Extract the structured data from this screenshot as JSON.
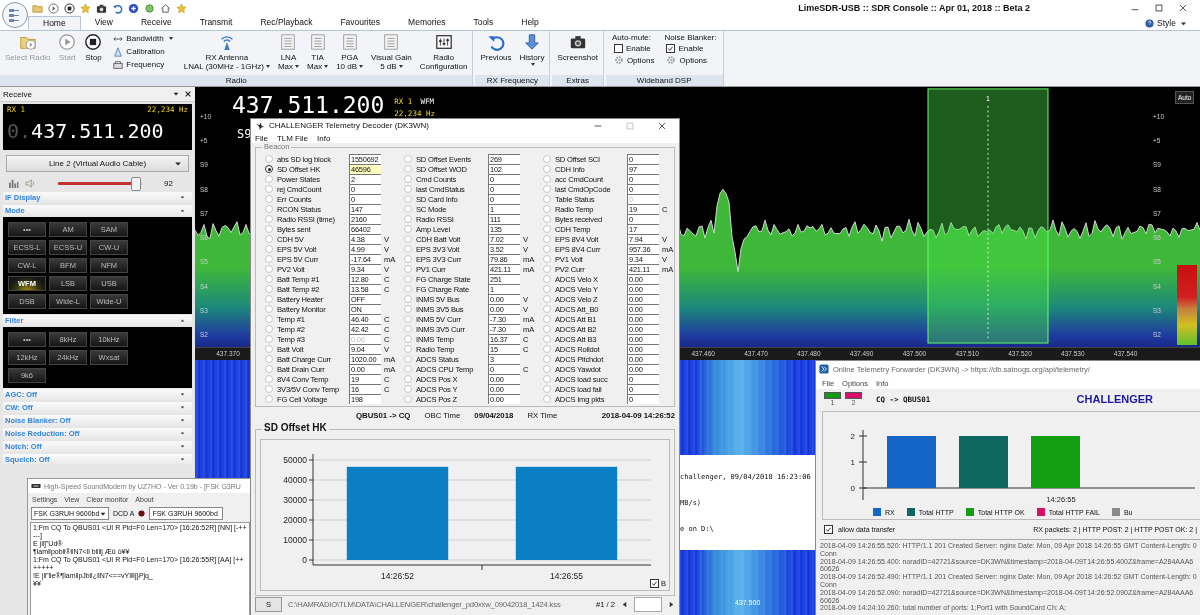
{
  "window": {
    "title": "LimeSDR-USB :: SDR Console :: Apr 01, 2018 :: Beta 2",
    "style_menu": "Style"
  },
  "tabs": [
    {
      "label": "Home",
      "selected": true
    },
    {
      "label": "View",
      "selected": false
    },
    {
      "label": "Receive",
      "selected": false
    },
    {
      "label": "Transmit",
      "selected": false
    },
    {
      "label": "Rec/Playback",
      "selected": false
    },
    {
      "label": "Favourites",
      "selected": false
    },
    {
      "label": "Memories",
      "selected": false
    },
    {
      "label": "Tools",
      "selected": false
    },
    {
      "label": "Help",
      "selected": false
    }
  ],
  "ribbon": [
    {
      "title": "Radio",
      "items": [
        {
          "kind": "large",
          "label": "Select Radio",
          "disabled": true,
          "dropdown": false
        },
        {
          "kind": "large",
          "label": "Start",
          "disabled": true,
          "dropdown": false
        },
        {
          "kind": "large",
          "label": "Stop",
          "disabled": false,
          "dropdown": false
        },
        {
          "kind": "stack",
          "rows": [
            {
              "label": "Bandwidth",
              "dropdown": true
            },
            {
              "label": "Calibration",
              "dropdown": false
            },
            {
              "label": "Frequency",
              "dropdown": false
            }
          ]
        },
        {
          "kind": "large",
          "label": "RX Antenna",
          "sub": "LNAL (30MHz - 1GHz)",
          "disabled": false,
          "dropdown": true
        },
        {
          "kind": "large",
          "label": "LNA",
          "sub": "Max",
          "disabled": false,
          "dropdown": true
        },
        {
          "kind": "large",
          "label": "TIA",
          "sub": "Max",
          "disabled": false,
          "dropdown": true
        },
        {
          "kind": "large",
          "label": "PGA",
          "sub": "10 dB",
          "disabled": false,
          "dropdown": true
        },
        {
          "kind": "large",
          "label": "Visual Gain",
          "sub": "5 dB",
          "disabled": false,
          "dropdown": true
        },
        {
          "kind": "large",
          "label": "Radio",
          "sub": "Configuration",
          "disabled": false,
          "dropdown": false
        }
      ]
    },
    {
      "title": "RX Frequency",
      "items": [
        {
          "kind": "large",
          "label": "Previous",
          "disabled": false,
          "dropdown": false
        },
        {
          "kind": "large",
          "label": "History",
          "disabled": false,
          "dropdown": true
        }
      ]
    },
    {
      "title": "Extras",
      "items": [
        {
          "kind": "large",
          "label": "Screenshot",
          "disabled": false,
          "dropdown": false
        }
      ]
    },
    {
      "title": "Wideband DSP",
      "items": [
        {
          "kind": "checks",
          "label": "Auto-mute:",
          "check": "Enable",
          "checked": false,
          "options": "Options"
        },
        {
          "kind": "checks",
          "label": "Noise Blanker:",
          "check": "Enable",
          "checked": true,
          "options": "Options"
        }
      ]
    }
  ],
  "receive_panel": {
    "title": "Receive",
    "rx": "RX 1",
    "offset": "22,234 Hz",
    "freq_prefix": "0.",
    "freq": "437.511.200",
    "audio_device": "Line 2 (Virtual Audio Cable)",
    "volume": {
      "level": 0.92,
      "reading": "92"
    },
    "sections": [
      {
        "title": "IF Display",
        "expanded": false
      },
      {
        "title": "Mode",
        "expanded": true,
        "buttons": [
          {
            "label": "•••",
            "selected": false
          },
          {
            "label": "AM",
            "selected": false
          },
          {
            "label": "SAM",
            "selected": false
          },
          {
            "label": "ECSS-L",
            "selected": false
          },
          {
            "label": "ECSS-U",
            "selected": false
          },
          {
            "label": "CW-U",
            "selected": false
          },
          {
            "label": "CW-L",
            "selected": false
          },
          {
            "label": "BFM",
            "selected": false
          },
          {
            "label": "NFM",
            "selected": false
          },
          {
            "label": "WFM",
            "selected": true
          },
          {
            "label": "LSB",
            "selected": false
          },
          {
            "label": "USB",
            "selected": false
          },
          {
            "label": "DSB",
            "selected": false
          },
          {
            "label": "Wide-L",
            "selected": false
          },
          {
            "label": "Wide-U",
            "selected": false
          }
        ]
      },
      {
        "title": "Filter",
        "expanded": true,
        "buttons": [
          {
            "label": "•••",
            "selected": false
          },
          {
            "label": "8kHz",
            "selected": false
          },
          {
            "label": "10kHz",
            "selected": false
          },
          {
            "label": "12kHz",
            "selected": false
          },
          {
            "label": "24kHz",
            "selected": false
          },
          {
            "label": "Wxsat",
            "selected": false
          },
          {
            "label": "9k6",
            "selected": false
          }
        ]
      },
      {
        "title": "AGC: Off",
        "expanded": false
      },
      {
        "title": "CW: Off",
        "expanded": false
      },
      {
        "title": "Noise Blanker: Off",
        "expanded": false
      },
      {
        "title": "Noise Reduction: Off",
        "expanded": false
      },
      {
        "title": "Notch: Off",
        "expanded": false
      },
      {
        "title": "Squelch: Off",
        "expanded": false
      }
    ]
  },
  "spectrum": {
    "freq": "437.511.200",
    "rx": "RX 1",
    "mode": "WFM",
    "offset": "22,234 Hz",
    "s_meter": "S9",
    "auto_button": "Auto",
    "selection_label": "1",
    "scale": [
      "+10",
      "+5",
      "S9",
      "S8",
      "S7",
      "S6",
      "S5",
      "S4",
      "S3",
      "S2"
    ],
    "scale_right": [
      "+10",
      "+5",
      "S9",
      "S8",
      "S7",
      "S6",
      "S5",
      "S4",
      "S3",
      "S2"
    ],
    "axis": [
      "437.370",
      "437.460",
      "437.470",
      "437.480",
      "437.490",
      "437.500",
      "437.510",
      "437.520",
      "437.530",
      "437.540"
    ],
    "waterfall_label": "437.500"
  },
  "background_window": {
    "lines": [
      "challenger,  09/04/2018 16:23:06",
      "MB/s)",
      "e on D:\\"
    ]
  },
  "decoder": {
    "title": "CHALLENGER Telemetry Decoder (DK3WN)",
    "menu": [
      "File",
      "TLM File",
      "Info"
    ],
    "beacon": {
      "title": "Beacon",
      "columns": [
        [
          {
            "label": "abs SD log block",
            "value": "1550692",
            "selected": false,
            "disabled": false
          },
          {
            "label": "SD Offset HK",
            "value": "46596",
            "selected": true,
            "disabled": false
          },
          {
            "label": "Power States",
            "value": "2",
            "selected": false,
            "disabled": false
          },
          {
            "label": "rej CmdCount",
            "value": "0",
            "selected": false,
            "disabled": false
          },
          {
            "label": "Err Counts",
            "value": "0",
            "selected": false,
            "disabled": false
          },
          {
            "label": "RCON Status",
            "value": "147",
            "selected": false,
            "disabled": false
          },
          {
            "label": "Radio RSSI (time)",
            "value": "2160",
            "selected": false,
            "disabled": false
          },
          {
            "label": "Bytes sent",
            "value": "66402",
            "selected": false,
            "disabled": false
          },
          {
            "label": "CDH 5V",
            "value": "4.38",
            "unit": "V",
            "selected": false,
            "disabled": false
          },
          {
            "label": "EPS 5V Volt",
            "value": "4.99",
            "unit": "V",
            "selected": false,
            "disabled": false
          },
          {
            "label": "EPS 5V Curr",
            "value": "-17.64",
            "unit": "mA",
            "selected": false,
            "disabled": false
          },
          {
            "label": "PV2 Volt",
            "value": "9.34",
            "unit": "V",
            "selected": false,
            "disabled": false
          },
          {
            "label": "Batt Temp #1",
            "value": "12.80",
            "unit": "C",
            "selected": false,
            "disabled": false
          },
          {
            "label": "Batt Temp #2",
            "value": "13.58",
            "unit": "C",
            "selected": false,
            "disabled": false
          },
          {
            "label": "Battery Heater",
            "value": "OFF",
            "selected": false,
            "disabled": false
          },
          {
            "label": "Battery Monitor",
            "value": "ON",
            "selected": false,
            "disabled": false
          },
          {
            "label": "Temp #1",
            "value": "46.40",
            "unit": "C",
            "selected": false,
            "disabled": false
          },
          {
            "label": "Temp #2",
            "value": "42.42",
            "unit": "C",
            "selected": false,
            "disabled": false
          },
          {
            "label": "Temp #3",
            "value": "0.00",
            "unit": "C",
            "selected": false,
            "disabled": true
          },
          {
            "label": "Batt Volt",
            "value": "9.04",
            "unit": "V",
            "selected": false,
            "disabled": false
          },
          {
            "label": "Batt Charge Curr",
            "value": "1020.00",
            "unit": "mA",
            "selected": false,
            "disabled": false
          },
          {
            "label": "Batt Drain Curr",
            "value": "0.00",
            "unit": "mA",
            "selected": false,
            "disabled": false
          },
          {
            "label": "8V4 Conv Temp",
            "value": "19",
            "unit": "C",
            "selected": false,
            "disabled": false
          },
          {
            "label": "3V3/5V Conv Temp",
            "value": "16",
            "unit": "C",
            "selected": false,
            "disabled": false
          },
          {
            "label": "FG Cell Voltage",
            "value": "198",
            "selected": false,
            "disabled": false
          }
        ],
        [
          {
            "label": "SD Offset Events",
            "value": "269",
            "selected": false,
            "disabled": false
          },
          {
            "label": "SD Offset WOD",
            "value": "102",
            "selected": false,
            "disabled": false
          },
          {
            "label": "Cmd Counts",
            "value": "0",
            "selected": false,
            "disabled": false
          },
          {
            "label": "last CmdStatus",
            "value": "0",
            "selected": false,
            "disabled": false
          },
          {
            "label": "SD Card Info",
            "value": "0",
            "selected": false,
            "disabled": false
          },
          {
            "label": "SC Mode",
            "value": "1",
            "selected": false,
            "disabled": false
          },
          {
            "label": "Radio RSSI",
            "value": "111",
            "selected": false,
            "disabled": false
          },
          {
            "label": "Amp Level",
            "value": "135",
            "selected": false,
            "disabled": false
          },
          {
            "label": "CDH Batt Volt",
            "value": "7.02",
            "unit": "V",
            "selected": false,
            "disabled": false
          },
          {
            "label": "EPS 3V3 Volt",
            "value": "3.52",
            "unit": "V",
            "selected": false,
            "disabled": false
          },
          {
            "label": "EPS 3V3 Curr",
            "value": "79.86",
            "unit": "mA",
            "selected": false,
            "disabled": false
          },
          {
            "label": "PV1 Curr",
            "value": "421.11",
            "unit": "mA",
            "selected": false,
            "disabled": false
          },
          {
            "label": "FG Charge State",
            "value": "251",
            "selected": false,
            "disabled": false
          },
          {
            "label": "FG Charge Rate",
            "value": "1",
            "selected": false,
            "disabled": false
          },
          {
            "label": "INMS 5V Bus",
            "value": "0.00",
            "unit": "V",
            "selected": false,
            "disabled": false
          },
          {
            "label": "INMS 3V5 Bus",
            "value": "0.00",
            "unit": "V",
            "selected": false,
            "disabled": false
          },
          {
            "label": "INMS 5V Curr",
            "value": "-7.30",
            "unit": "mA",
            "selected": false,
            "disabled": false
          },
          {
            "label": "INMS 3V5 Curr",
            "value": "-7.30",
            "unit": "mA",
            "selected": false,
            "disabled": false
          },
          {
            "label": "INMS Temp",
            "value": "16.37",
            "unit": "C",
            "selected": false,
            "disabled": false
          },
          {
            "label": "Radio Temp",
            "value": "15",
            "unit": "C",
            "selected": false,
            "disabled": false
          },
          {
            "label": "ADCS Status",
            "value": "3",
            "selected": false,
            "disabled": false
          },
          {
            "label": "ADCS CPU Temp",
            "value": "0",
            "unit": "C",
            "selected": false,
            "disabled": false
          },
          {
            "label": "ADCS Pos X",
            "value": "0.00",
            "selected": false,
            "disabled": false
          },
          {
            "label": "ADCS Pos Y",
            "value": "0.00",
            "selected": false,
            "disabled": false
          },
          {
            "label": "ADCS Pos Z",
            "value": "0.00",
            "selected": false,
            "disabled": false
          }
        ],
        [
          {
            "label": "SD Offset SCI",
            "value": "0",
            "selected": false,
            "disabled": false
          },
          {
            "label": "CDH Info",
            "value": "97",
            "selected": false,
            "disabled": false
          },
          {
            "label": "acc CmdCount",
            "value": "0",
            "selected": false,
            "disabled": false
          },
          {
            "label": "last CmdOpCode",
            "value": "0",
            "selected": false,
            "disabled": false
          },
          {
            "label": "Table Status",
            "value": "0",
            "selected": false,
            "disabled": true
          },
          {
            "label": "Radio Temp",
            "value": "19",
            "unit": "C",
            "selected": false,
            "disabled": false
          },
          {
            "label": "Bytes received",
            "value": "0",
            "selected": false,
            "disabled": false
          },
          {
            "label": "CDH Temp",
            "value": "17",
            "selected": false,
            "disabled": false
          },
          {
            "label": "EPS 8V4 Volt",
            "value": "7.94",
            "unit": "V",
            "selected": false,
            "disabled": false
          },
          {
            "label": "EPS 8V4 Curr",
            "value": "957.36",
            "unit": "mA",
            "selected": false,
            "disabled": false
          },
          {
            "label": "PV1 Volt",
            "value": "9.34",
            "unit": "V",
            "selected": false,
            "disabled": false
          },
          {
            "label": "PV2 Curr",
            "value": "421.11",
            "unit": "mA",
            "selected": false,
            "disabled": false
          },
          {
            "label": "ADCS Velo X",
            "value": "0.00",
            "selected": false,
            "disabled": false
          },
          {
            "label": "ADCS Velo Y",
            "value": "0.00",
            "selected": false,
            "disabled": false
          },
          {
            "label": "ADCS Velo Z",
            "value": "0.00",
            "selected": false,
            "disabled": false
          },
          {
            "label": "ADCS Att_B0",
            "value": "0.00",
            "selected": false,
            "disabled": false
          },
          {
            "label": "ADCS Att B1",
            "value": "0.00",
            "selected": false,
            "disabled": false
          },
          {
            "label": "ADCS Att B2",
            "value": "0.00",
            "selected": false,
            "disabled": false
          },
          {
            "label": "ADCS Att B3",
            "value": "0.00",
            "selected": false,
            "disabled": false
          },
          {
            "label": "ADCS Rolldot",
            "value": "0.00",
            "selected": false,
            "disabled": false
          },
          {
            "label": "ADCS Pitchdot",
            "value": "0.00",
            "selected": false,
            "disabled": false
          },
          {
            "label": "ADCS Yawdot",
            "value": "0.00",
            "selected": false,
            "disabled": false
          },
          {
            "label": "ADCS load succ",
            "value": "0",
            "selected": false,
            "disabled": false
          },
          {
            "label": "ADCS load fail",
            "value": "0",
            "selected": false,
            "disabled": false
          },
          {
            "label": "ADCS Img pkts",
            "value": "0",
            "selected": false,
            "disabled": false
          }
        ]
      ]
    },
    "info": {
      "route": "QBUS01 -> CQ",
      "obc_label": "OBC Time",
      "obc_time": "09/04/2018",
      "rx_label": "RX Time",
      "rx_time": "2018-04-09 14:26:52"
    },
    "chart": {
      "b_checkbox": {
        "checked": true
      },
      "chart_data": {
        "type": "bar",
        "title": "SD Offset HK",
        "grid": true,
        "categories": [
          "14:26:52",
          "14:26:55"
        ],
        "series": [
          {
            "name": "B",
            "color": "#0a7fc4",
            "values": [
              46600,
              46600
            ]
          }
        ],
        "ylim": [
          0,
          50000
        ],
        "yticks": [
          0,
          10000,
          20000,
          30000,
          40000,
          50000
        ]
      }
    },
    "status": {
      "button": "S",
      "path": "C:\\HAMRADIO\\TLM\\DATA\\CHALLENGER\\challenger_pd0xxw_09042018_1424.kss",
      "page": "#1 / 2"
    }
  },
  "soundmodem": {
    "title": "High-Speed SoundModem by UZ7HO - Ver 0.19b - [FSK G3RU",
    "menu": [
      "Settings",
      "View",
      "Clear monitor",
      "About"
    ],
    "mode_a": "FSK G3RUH 9600bd",
    "dcd": "DCD A",
    "mode_b": "FSK G3RUH 9600bd",
    "monitor": [
      "1:Fm CQ To QBUS01 <UI R Pid=F0 Len=170> [16:26:52R] [NN] [-++---]",
      "E j‖]”Ud®",
      "¶lam‖pob‖®‖N7<ll b‖‖j Æû ò¥¥",
      "1:Fm CQ To QBUS01 <UI R Pid=F0 Len=170> [16:26:55R] [AA] [+++++++",
      "!E |‖”‖e®¶lam‖pJb‖¿‖N7<==vY‖‖j}Pjq_",
      "¥¥"
    ]
  },
  "forwarder": {
    "title": "Online Telemetry Forwarder (DK3WN) -> https://db.satnogs.org/api/telemetry/",
    "menu": [
      "File",
      "Options",
      "Info"
    ],
    "indicators": [
      {
        "label": "1",
        "color": "#119a11"
      },
      {
        "label": "2",
        "color": "#d8106a"
      }
    ],
    "route": "CQ -> QBUS01",
    "satellite": "CHALLENGER",
    "chart_data": {
      "type": "bar",
      "categories": [
        "14:26:55"
      ],
      "series": [
        {
          "name": "RX",
          "color": "#1565c8",
          "values": [
            2
          ]
        },
        {
          "name": "Total HTTP",
          "color": "#0e6660",
          "values": [
            2
          ]
        },
        {
          "name": "Total HTTP OK",
          "color": "#12a012",
          "values": [
            2
          ]
        },
        {
          "name": "Total HTTP FAIL",
          "color": "#d8106a",
          "values": [
            0
          ]
        },
        {
          "name": "Bu",
          "color": "#8a8a8a",
          "values": [
            null
          ]
        }
      ],
      "ylim": [
        0,
        2
      ],
      "yticks": [
        0,
        1,
        2
      ],
      "legend": "bottom"
    },
    "allow_transfer": {
      "label": "allow data transfer",
      "checked": true
    },
    "counters": "RX packets: 2 | HTTP POST: 2 | HTTP POST OK: 2 |",
    "log": [
      "2018-04-09 14:26:55.520: HTTP/1.1 201 Created Server: nginx Date: Mon, 09 Apr 2018 14:26:55 GMT Content-Length: 0 Conn",
      "2018-04-09 14:26:55.400: noradID=42721&source=DK3WN&timestamp=2018-04-09T14:26:55.400Z&frame=A284AAA660626",
      "2018-04-09 14:26:52.490: HTTP/1.1 201 Created Server: nginx Date: Mon, 09 Apr 2018 14:26:52 GMT Content-Length: 0 Conn",
      "2018-04-09 14:26:52.090: noradID=42721&source=DK3WN&timestamp=2018-04-09T14:26:52.090Z&frame=A284AAA660626",
      "2018-04-09 14:24:10.260: total number of ports: 1;Port1 with SoundCard Ch: A;"
    ]
  }
}
